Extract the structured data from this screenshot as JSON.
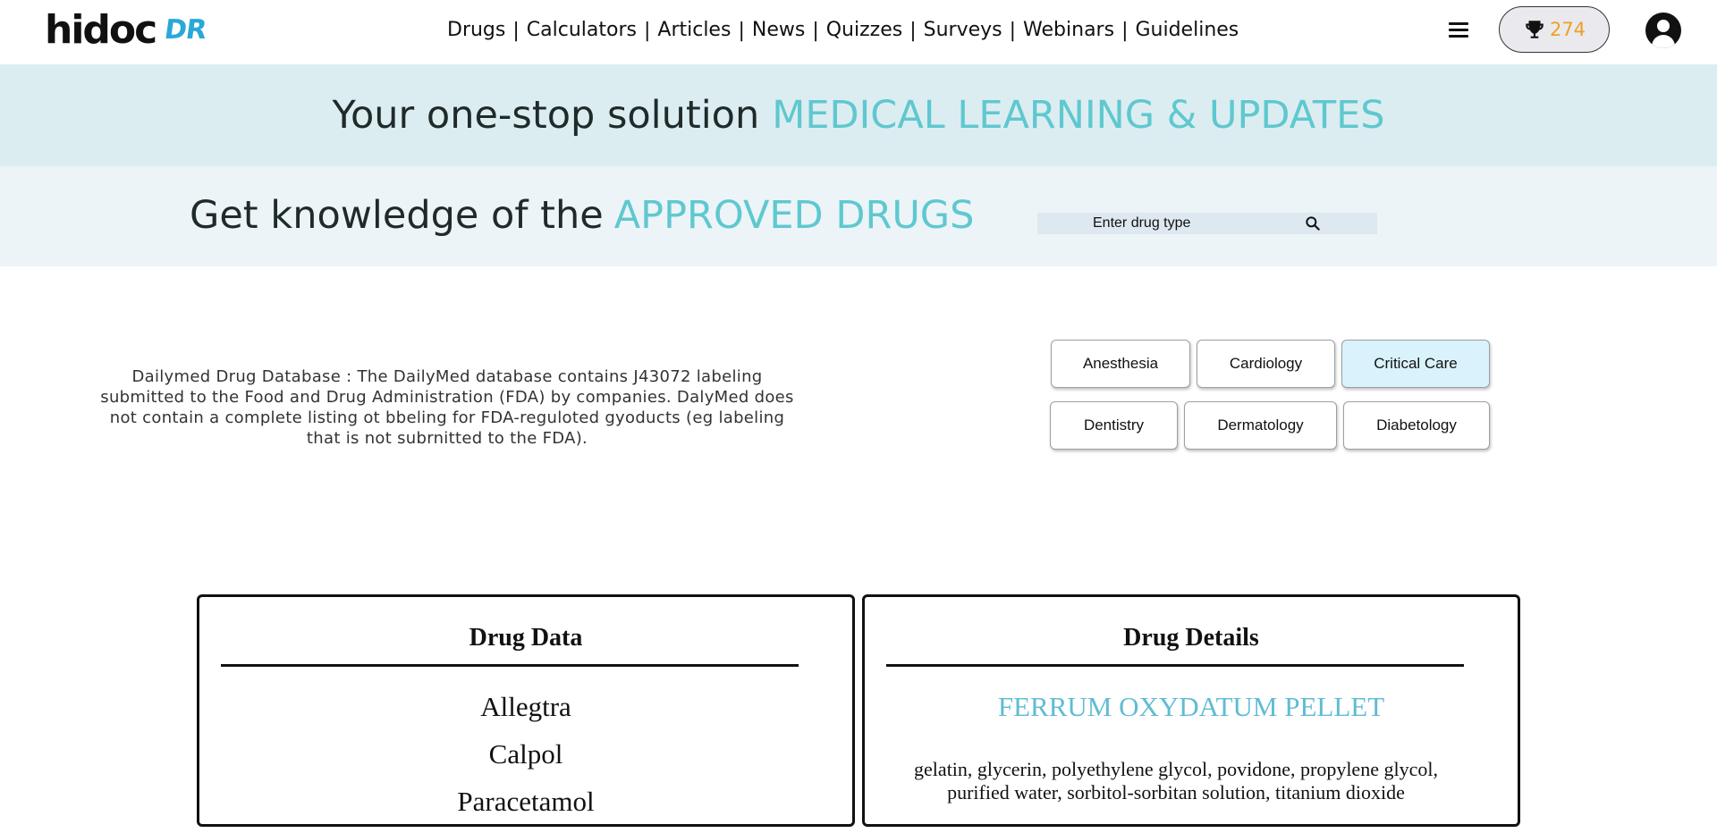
{
  "header": {
    "logo_main": "hidoc",
    "logo_sub": "DR",
    "nav": [
      "Drugs",
      "Calculators",
      "Articles",
      "News",
      "Quizzes",
      "Surveys",
      "Webinars",
      "Guidelines"
    ],
    "score": "274"
  },
  "banner1": {
    "lead": "Your one-stop solution",
    "accent": "MEDICAL LEARNING & UPDATES"
  },
  "banner2": {
    "lead": "Get knowledge of the",
    "accent": "APPROVED DRUGS"
  },
  "search": {
    "placeholder": "Enter drug type"
  },
  "description": "Dailymed Drug Database : The DailyMed database contains J43072 labeling submitted to the Food and Drug Administration (FDA) by companies. DalyMed does not contain a complete listing ot bbeling for FDA-reguloted gyoducts (eg labeling that is not subrnitted to the FDA).",
  "categories": [
    "Anesthesia",
    "Cardiology",
    "Critical Care",
    "Dentistry",
    "Dermatology",
    "Diabetology"
  ],
  "active_category": "Critical Care",
  "drug_data": {
    "title": "Drug Data",
    "items": [
      "Allegtra",
      "Calpol",
      "Paracetamol"
    ]
  },
  "drug_details": {
    "title": "Drug Details",
    "name": "FERRUM OXYDATUM PELLET",
    "ingredients": "gelatin, glycerin, polyethylene glycol, povidone, propylene glycol, purified water, sorbitol-sorbitan solution, titanium dioxide"
  },
  "colors": {
    "accent": "#5fc8cf",
    "banner1_bg": "#dcedf1",
    "banner2_bg": "#ecf4f8",
    "score": "#f0a020",
    "active_button": "#d9f2fb"
  }
}
